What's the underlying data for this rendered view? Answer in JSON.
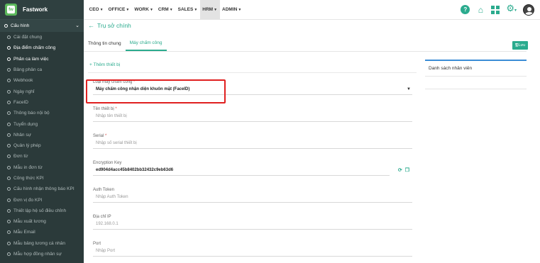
{
  "brand": {
    "name": "Fastwork",
    "logo_text": "fw"
  },
  "sidebar": {
    "section": "Cấu hình",
    "items": [
      {
        "label": "Cài đặt chung",
        "active": false
      },
      {
        "label": "Địa điểm chấm công",
        "active": true
      },
      {
        "label": "Phân ca làm việc",
        "active": true
      },
      {
        "label": "Bảng phân ca",
        "active": false
      },
      {
        "label": "Webhook",
        "active": false
      },
      {
        "label": "Ngày nghỉ",
        "active": false
      },
      {
        "label": "FaceID",
        "active": false
      },
      {
        "label": "Thông báo nội bộ",
        "active": false
      },
      {
        "label": "Tuyển dụng",
        "active": false
      },
      {
        "label": "Nhân sự",
        "active": false
      },
      {
        "label": "Quản lý phép",
        "active": false
      },
      {
        "label": "Đơn từ",
        "active": false
      },
      {
        "label": "Mẫu in đơn từ",
        "active": false
      },
      {
        "label": "Công thức KPI",
        "active": false
      },
      {
        "label": "Cấu hình nhận thông báo KPI",
        "active": false
      },
      {
        "label": "Đơn vị đo KPI",
        "active": false
      },
      {
        "label": "Thiết lập hệ số điều chỉnh",
        "active": false
      },
      {
        "label": "Mẫu xuất lương",
        "active": false
      },
      {
        "label": "Mẫu Email",
        "active": false
      },
      {
        "label": "Mẫu bảng lương cá nhân",
        "active": false
      },
      {
        "label": "Mẫu hợp đồng nhân sự",
        "active": false
      }
    ]
  },
  "topmenu": {
    "items": [
      {
        "label": "CEO",
        "active": false
      },
      {
        "label": "OFFICE",
        "active": false
      },
      {
        "label": "WORK",
        "active": false
      },
      {
        "label": "CRM",
        "active": false
      },
      {
        "label": "SALES",
        "active": false
      },
      {
        "label": "HRM",
        "active": true
      },
      {
        "label": "ADMIN",
        "active": false
      }
    ],
    "help_symbol": "?",
    "gear_caret": "▾"
  },
  "page": {
    "title": "Trụ sở chính",
    "tabs": [
      {
        "label": "Thông tin chung",
        "active": false
      },
      {
        "label": "Máy chấm công",
        "active": true
      }
    ],
    "save_label": "Lưu"
  },
  "form": {
    "add_device_label": "Thêm thiết bị",
    "device_type": {
      "label": "Loại máy chấm công",
      "value": "Máy chấm công nhận diện khuôn mặt (FaceID)"
    },
    "device_name": {
      "label": "Tên thiết bị",
      "placeholder": "Nhập tên thiết bị"
    },
    "serial": {
      "label": "Serial",
      "placeholder": "Nhập số serial thiết bị"
    },
    "encryption_key": {
      "label": "Encryption Key",
      "value": "ed904d4acc45b8402bb32432c9eb63d6"
    },
    "auth_token": {
      "label": "Auth Token",
      "placeholder": "Nhập Auth Token"
    },
    "ip": {
      "label": "Địa chỉ IP",
      "placeholder": "192.168.0.1"
    },
    "port": {
      "label": "Port",
      "placeholder": "Nhập Port"
    }
  },
  "right_panel": {
    "title": "Danh sách nhân viên"
  },
  "colors": {
    "accent": "#2bab8e",
    "sidebar_bg": "#2b3a3a",
    "highlight": "#e02020",
    "panel_border": "#3b8dd6"
  }
}
